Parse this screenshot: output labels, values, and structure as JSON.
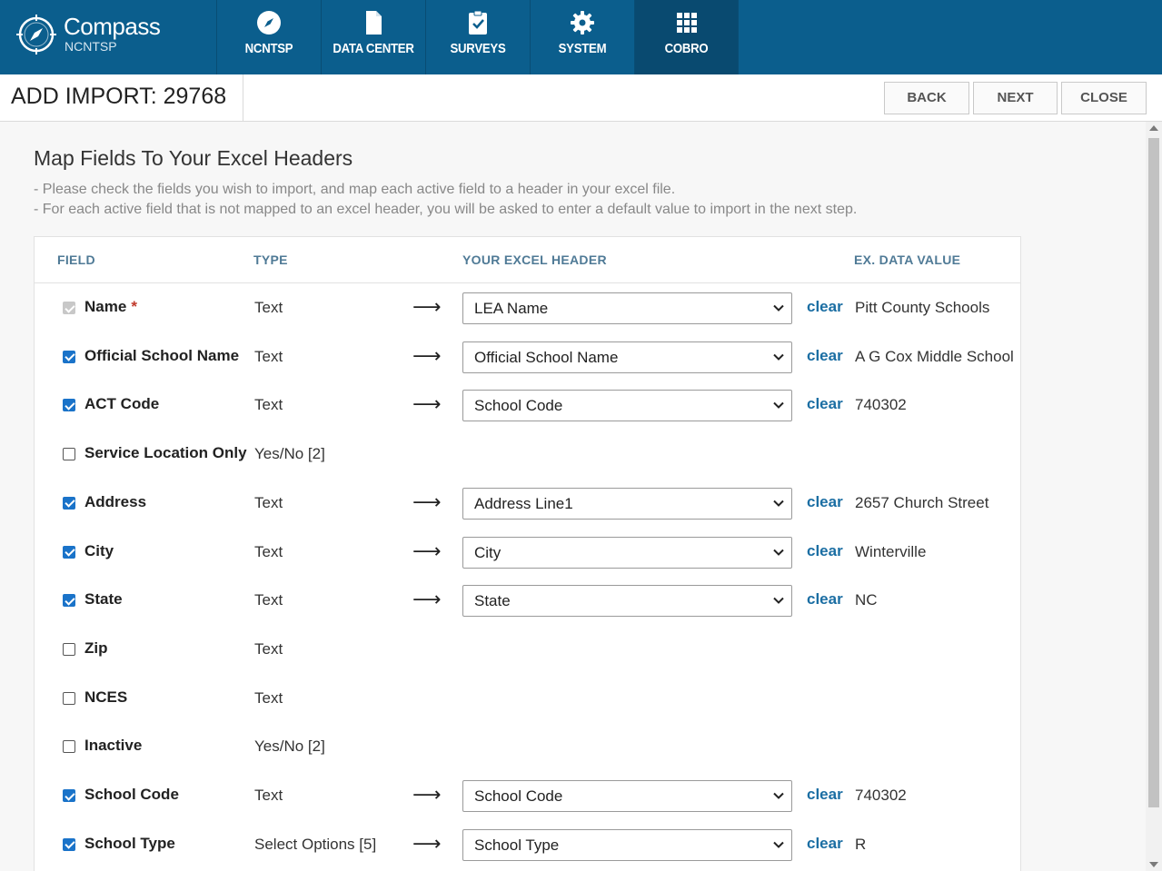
{
  "brand": {
    "name": "Compass",
    "sub": "NCNTSP"
  },
  "nav": [
    {
      "label": "NCNTSP",
      "icon": "compass-icon"
    },
    {
      "label": "DATA CENTER",
      "icon": "document-icon"
    },
    {
      "label": "SURVEYS",
      "icon": "clipboard-check-icon"
    },
    {
      "label": "SYSTEM",
      "icon": "gear-icon"
    },
    {
      "label": "COBRO",
      "icon": "grid-icon",
      "active": true
    }
  ],
  "page": {
    "title": "ADD IMPORT: 29768"
  },
  "toolbar": {
    "back": "BACK",
    "next": "NEXT",
    "close": "CLOSE"
  },
  "section": {
    "title": "Map Fields To Your Excel Headers",
    "instructions": [
      "- Please check the fields you wish to import, and map each active field to a header in your excel file.",
      "- For each active field that is not mapped to an excel header, you will be asked to enter a default value to import in the next step."
    ]
  },
  "table": {
    "headers": {
      "field": "FIELD",
      "type": "TYPE",
      "excel": "YOUR EXCEL HEADER",
      "example": "EX. DATA VALUE"
    },
    "arrow": "⟶",
    "clear_label": "clear",
    "required_mark": "*",
    "rows": [
      {
        "field": "Name",
        "required": true,
        "state": "disabled",
        "type": "Text",
        "header": "LEA Name",
        "example": "Pitt County Schools"
      },
      {
        "field": "Official School Name",
        "state": "on",
        "type": "Text",
        "header": "Official School Name",
        "example": "A G Cox Middle School"
      },
      {
        "field": "ACT Code",
        "state": "on",
        "type": "Text",
        "header": "School Code",
        "example": "740302"
      },
      {
        "field": "Service Location Only",
        "state": "off",
        "type": "Yes/No [2]",
        "header": "",
        "example": ""
      },
      {
        "field": "Address",
        "state": "on",
        "type": "Text",
        "header": "Address Line1",
        "example": "2657 Church Street"
      },
      {
        "field": "City",
        "state": "on",
        "type": "Text",
        "header": "City",
        "example": "Winterville"
      },
      {
        "field": "State",
        "state": "on",
        "type": "Text",
        "header": "State",
        "example": "NC"
      },
      {
        "field": "Zip",
        "state": "off",
        "type": "Text",
        "header": "",
        "example": ""
      },
      {
        "field": "NCES",
        "state": "off",
        "type": "Text",
        "header": "",
        "example": ""
      },
      {
        "field": "Inactive",
        "state": "off",
        "type": "Yes/No [2]",
        "header": "",
        "example": ""
      },
      {
        "field": "School Code",
        "state": "on",
        "type": "Text",
        "header": "School Code",
        "example": "740302"
      },
      {
        "field": "School Type",
        "state": "on",
        "type": "Select Options [5]",
        "header": "School Type",
        "example": "R"
      }
    ]
  },
  "colors": {
    "nav_bg": "#0b5e8d",
    "nav_active": "#094a70",
    "accent_link": "#1b6ea3",
    "checkbox": "#1a73c9",
    "header_text": "#4f7a96"
  }
}
